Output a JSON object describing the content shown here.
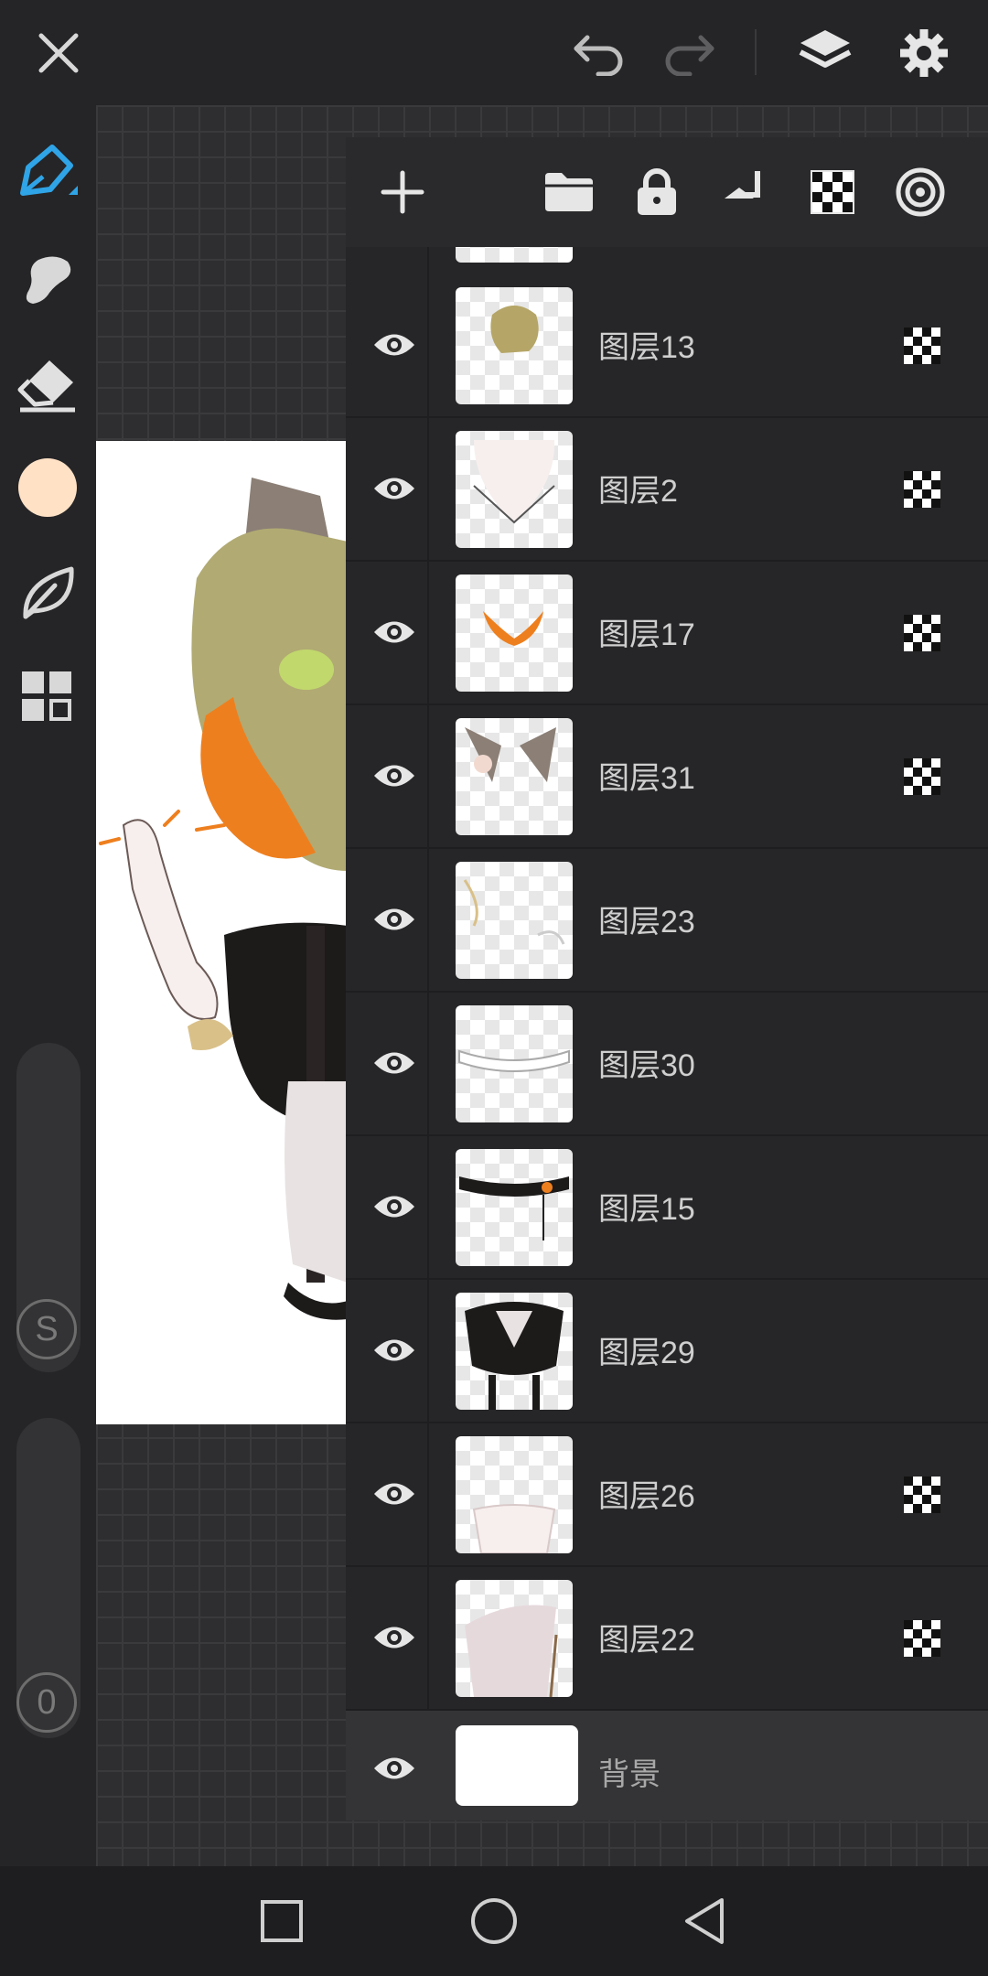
{
  "top_bar": {
    "close_icon": "close-icon",
    "undo_icon": "undo-icon",
    "redo_icon": "redo-icon",
    "layers_icon": "layers-icon",
    "settings_icon": "gear-icon"
  },
  "tools": [
    {
      "name": "brush",
      "icon": "pen-icon",
      "active": true
    },
    {
      "name": "smudge",
      "icon": "smudge-icon"
    },
    {
      "name": "eraser",
      "icon": "eraser-icon"
    },
    {
      "name": "color",
      "icon": "color-swatch",
      "color": "#ffe1c6"
    },
    {
      "name": "brush-library",
      "icon": "leaf-icon"
    },
    {
      "name": "gallery",
      "icon": "grid-icon"
    }
  ],
  "sliders": {
    "size_label": "S",
    "opacity_label": "0"
  },
  "layers_panel": {
    "toolbar": [
      "add-icon",
      "folder-icon",
      "lock-icon",
      "merge-down-icon",
      "alpha-lock-icon",
      "blend-mode-icon"
    ],
    "layers": [
      {
        "name": "图层13",
        "alpha_lock": true
      },
      {
        "name": "图层2",
        "alpha_lock": true
      },
      {
        "name": "图层17",
        "alpha_lock": true
      },
      {
        "name": "图层31",
        "alpha_lock": true
      },
      {
        "name": "图层23",
        "alpha_lock": false
      },
      {
        "name": "图层30",
        "alpha_lock": false
      },
      {
        "name": "图层15",
        "alpha_lock": false
      },
      {
        "name": "图层29",
        "alpha_lock": false
      },
      {
        "name": "图层26",
        "alpha_lock": true
      },
      {
        "name": "图层22",
        "alpha_lock": true
      }
    ],
    "background_layer": {
      "name": "背景"
    }
  },
  "nav_bar": [
    "recent-apps-icon",
    "home-icon",
    "back-icon"
  ],
  "colors": {
    "accent": "#2fa4e7",
    "panel": "#262628",
    "text": "#cfcfcf"
  }
}
